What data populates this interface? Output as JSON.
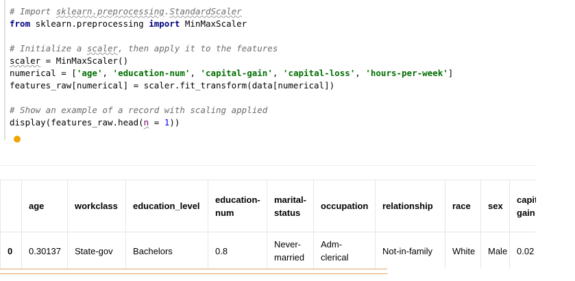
{
  "code": {
    "line1_comment_prefix": "# Import ",
    "line1_comment_module": "sklearn.preprocessing",
    "line1_comment_dot": ".",
    "line1_comment_class": "StandardScaler",
    "line2_kw_from": "from",
    "line2_module": " sklearn.preprocessing ",
    "line2_kw_import": "import",
    "line2_name": " MinMaxScaler",
    "line4_comment_a": "# Initialize a ",
    "line4_comment_scaler": "scaler",
    "line4_comment_b": ", then apply it to the features",
    "line5_scaler": "scaler",
    "line5_rest": " = MinMaxScaler()",
    "line6_prefix": "numerical = [",
    "line6_s1": "'age'",
    "line6_c1": ", ",
    "line6_s2": "'education-num'",
    "line6_c2": ", ",
    "line6_s3": "'capital-gain'",
    "line6_c3": ", ",
    "line6_s4": "'capital-loss'",
    "line6_c4": ", ",
    "line6_s5": "'hours-per-week'",
    "line6_suffix": "]",
    "line7": "features_raw[numerical] = scaler.fit_transform(data[numerical])",
    "line9_comment": "# Show an example of a record with scaling applied",
    "line10_prefix": "display(features_raw.head(",
    "line10_n": "n",
    "line10_eq": " = ",
    "line10_num": "1",
    "line10_suffix": "))"
  },
  "table": {
    "headers": [
      "",
      "age",
      "workclass",
      "education_level",
      "education-num",
      "marital-status",
      "occupation",
      "relationship",
      "race",
      "sex",
      "capital-gain"
    ],
    "rows": [
      [
        "0",
        "0.30137",
        "State-gov",
        "Bachelors",
        "0.8",
        "Never-married",
        "Adm-clerical",
        "Not-in-family",
        "White",
        "Male",
        "0.02"
      ]
    ]
  },
  "colors": {
    "keyword": "#000080",
    "string": "#006d00",
    "comment": "#6b6b6b",
    "running_indicator": "#f0a400"
  }
}
